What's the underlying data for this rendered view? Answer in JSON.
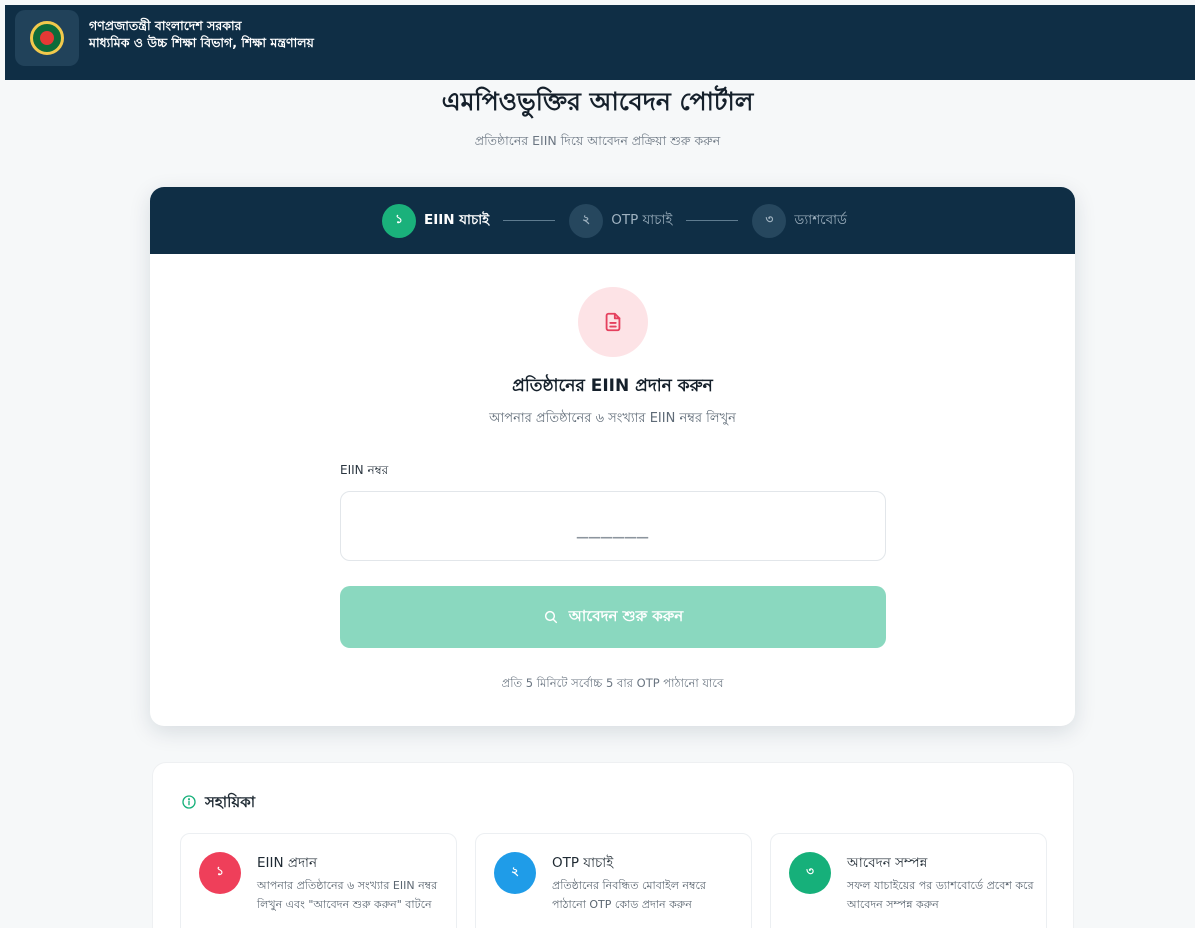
{
  "header": {
    "line1": "গণপ্রজাতন্ত্রী বাংলাদেশ সরকার",
    "line2": "মাধ্যমিক ও উচ্চ শিক্ষা বিভাগ, শিক্ষা মন্ত্রণালয়"
  },
  "page": {
    "title": "এমপিওভুক্তির আবেদন পোর্টাল",
    "subtitle": "প্রতিষ্ঠানের EIIN দিয়ে আবেদন প্রক্রিয়া শুরু করুন"
  },
  "stepper": {
    "steps": [
      {
        "num": "১",
        "label": "EIIN যাচাই"
      },
      {
        "num": "২",
        "label": "OTP যাচাই"
      },
      {
        "num": "৩",
        "label": "ড্যাশবোর্ড"
      }
    ]
  },
  "form": {
    "title": "প্রতিষ্ঠানের EIIN প্রদান করুন",
    "subtitle": "আপনার প্রতিষ্ঠানের ৬ সংখ্যার EIIN নম্বর লিখুন",
    "field_label": "EIIN নম্বর",
    "placeholder": "______",
    "submit_label": "আবেদন শুরু করুন",
    "rate_note": "প্রতি 5 মিনিটে সর্বোচ্চ 5 বার OTP পাঠানো যাবে"
  },
  "help": {
    "title": "সহায়িকা",
    "items": [
      {
        "num": "১",
        "title": "EIIN প্রদান",
        "desc": "আপনার প্রতিষ্ঠানের ৬ সংখ্যার EIIN নম্বর লিখুন এবং \"আবেদন শুরু করুন\" বাটনে",
        "color": "#ef3f5a"
      },
      {
        "num": "২",
        "title": "OTP যাচাই",
        "desc": "প্রতিষ্ঠানের নিবন্ধিত মোবাইল নম্বরে পাঠানো OTP কোড প্রদান করুন",
        "color": "#1f9ce8"
      },
      {
        "num": "৩",
        "title": "আবেদন সম্পন্ন",
        "desc": "সফল যাচাইয়ের পর ড্যাশবোর্ডে প্রবেশ করে আবেদন সম্পন্ন করুন",
        "color": "#16b07a"
      }
    ]
  },
  "colors": {
    "header_bg": "#0f2e45",
    "accent_green": "#1ab17b",
    "button_disabled": "#8ad8bf",
    "doc_icon": "#e5405e"
  },
  "icons": [
    "government-seal-icon",
    "document-icon",
    "search-icon",
    "info-icon"
  ]
}
